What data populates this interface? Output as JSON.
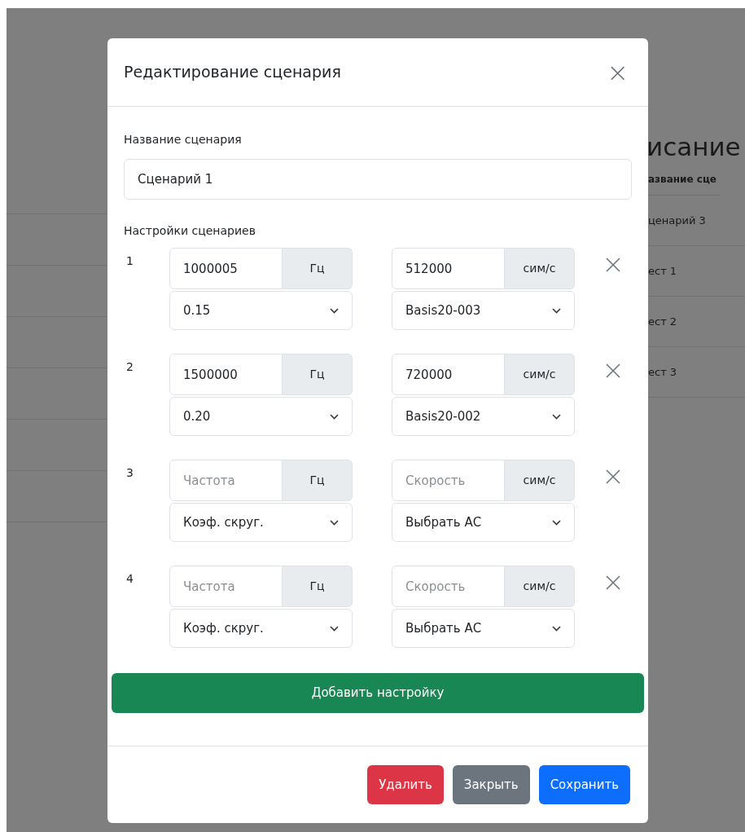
{
  "background": {
    "heading": "исание",
    "table": {
      "header": "азвание сце",
      "rows": [
        "ценарий 3",
        "ест 1",
        "ест 2",
        "ест 3"
      ]
    }
  },
  "modal": {
    "title": "Редактирование сценария",
    "close": "×",
    "name_field": {
      "label": "Название сценария",
      "value": "Сценарий 1"
    },
    "settings_label": "Настройки сценариев",
    "settings": [
      {
        "number": "1",
        "frequency": {
          "value": "1000005",
          "unit": "Гц"
        },
        "speed": {
          "value": "512000",
          "unit": "сим/с"
        },
        "coefficient": "0.15",
        "ac": "Basis20-003"
      },
      {
        "number": "2",
        "frequency": {
          "value": "1500000",
          "unit": "Гц"
        },
        "speed": {
          "value": "720000",
          "unit": "сим/с"
        },
        "coefficient": "0.20",
        "ac": "Basis20-002"
      },
      {
        "number": "3",
        "frequency": {
          "placeholder": "Частота",
          "unit": "Гц"
        },
        "speed": {
          "placeholder": "Скорость",
          "unit": "сим/с"
        },
        "coefficient": "Коэф. скруг.",
        "ac": "Выбрать АС"
      },
      {
        "number": "4",
        "frequency": {
          "placeholder": "Частота",
          "unit": "Гц"
        },
        "speed": {
          "placeholder": "Скорость",
          "unit": "сим/с"
        },
        "coefficient": "Коэф. скруг.",
        "ac": "Выбрать АС"
      }
    ],
    "add_button": "Добавить настройку",
    "footer_buttons": [
      {
        "label": "Удалить",
        "kind": "danger"
      },
      {
        "label": "Закрыть",
        "kind": "secondary"
      },
      {
        "label": "Сохранить",
        "kind": "primary"
      }
    ]
  }
}
